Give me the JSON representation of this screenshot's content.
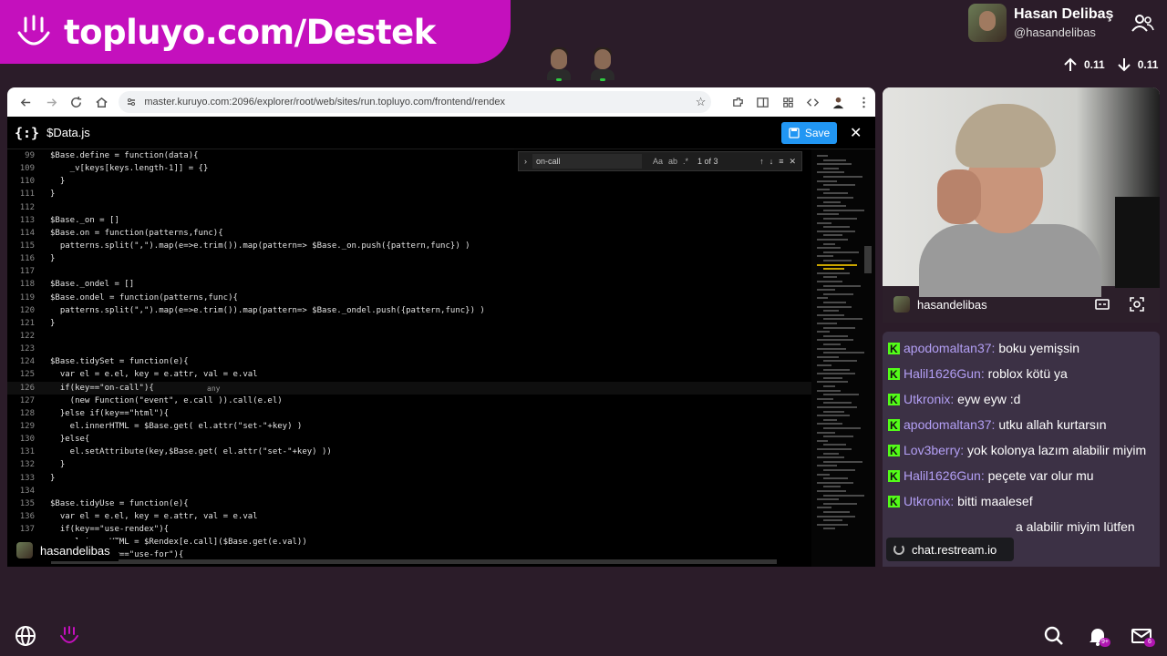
{
  "banner": {
    "text": "topluyo.com/Destek",
    "brand_color": "#c410bd"
  },
  "streamer": {
    "name": "Hasan Delibaş",
    "handle": "@hasandelibas"
  },
  "stats": {
    "up": "0.11",
    "down": "0.11"
  },
  "browser": {
    "url": "master.kuruyo.com:2096/explorer/root/web/sites/run.topluyo.com/frontend/rendex"
  },
  "editor": {
    "icon_text": "{:}",
    "filename": "$Data.js",
    "save_label": "Save",
    "find": {
      "query": "on-call",
      "count": "1 of 3"
    },
    "hover_hint": "any",
    "lines": [
      {
        "n": "99",
        "t": "$Base.define = function(data){"
      },
      {
        "n": "109",
        "t": "    _v[keys[keys.length-1]] = {}"
      },
      {
        "n": "110",
        "t": "  }"
      },
      {
        "n": "111",
        "t": "}"
      },
      {
        "n": "112",
        "t": ""
      },
      {
        "n": "113",
        "t": "$Base._on = []"
      },
      {
        "n": "114",
        "t": "$Base.on = function(patterns,func){"
      },
      {
        "n": "115",
        "t": "  patterns.split(\",\").map(e=>e.trim()).map(pattern=> $Base._on.push({pattern,func}) )"
      },
      {
        "n": "116",
        "t": "}"
      },
      {
        "n": "117",
        "t": ""
      },
      {
        "n": "118",
        "t": "$Base._ondel = []"
      },
      {
        "n": "119",
        "t": "$Base.ondel = function(patterns,func){"
      },
      {
        "n": "120",
        "t": "  patterns.split(\",\").map(e=>e.trim()).map(pattern=> $Base._ondel.push({pattern,func}) )"
      },
      {
        "n": "121",
        "t": "}"
      },
      {
        "n": "122",
        "t": ""
      },
      {
        "n": "123",
        "t": ""
      },
      {
        "n": "124",
        "t": "$Base.tidySet = function(e){"
      },
      {
        "n": "125",
        "t": "  var el = e.el, key = e.attr, val = e.val"
      },
      {
        "n": "126",
        "t": "  if(key==\"on-call\"){"
      },
      {
        "n": "127",
        "t": "    (new Function(\"event\", e.call )).call(e.el)"
      },
      {
        "n": "128",
        "t": "  }else if(key==\"html\"){"
      },
      {
        "n": "129",
        "t": "    el.innerHTML = $Base.get( el.attr(\"set-\"+key) )"
      },
      {
        "n": "130",
        "t": "  }else{"
      },
      {
        "n": "131",
        "t": "    el.setAttribute(key,$Base.get( el.attr(\"set-\"+key) ))"
      },
      {
        "n": "132",
        "t": "  }"
      },
      {
        "n": "133",
        "t": "}"
      },
      {
        "n": "134",
        "t": ""
      },
      {
        "n": "135",
        "t": "$Base.tidyUse = function(e){"
      },
      {
        "n": "136",
        "t": "  var el = e.el, key = e.attr, val = e.val"
      },
      {
        "n": "137",
        "t": "  if(key==\"use-rendex\"){"
      },
      {
        "n": "",
        "t": "    el.innerHTML = $Rendex[e.call]($Base.get(e.val))"
      },
      {
        "n": "",
        "t": "  }else if(key==\"use-for\"){"
      }
    ]
  },
  "strip_name": "hasandelibas",
  "cam": {
    "name": "hasandelibas"
  },
  "chat": {
    "messages": [
      {
        "user": "apodomaltan37:",
        "text": "boku yemişsin"
      },
      {
        "user": "Halil1626Gun:",
        "text": "roblox kötü ya"
      },
      {
        "user": "Utkronix:",
        "text": "eyw eyw :d"
      },
      {
        "user": "apodomaltan37:",
        "text": "utku allah kurtarsın"
      },
      {
        "user": "Lov3berry:",
        "text": "yok kolonya lazım alabilir miyim"
      },
      {
        "user": "Halil1626Gun:",
        "text": "peçete var olur mu"
      },
      {
        "user": "Utkronix:",
        "text": "bitti maalesef"
      },
      {
        "user": "",
        "text": "a alabilir miyim lütfen"
      }
    ],
    "overlay": "chat.restream.io"
  },
  "bottom": {
    "notif_badge": "9+",
    "mail_badge": "6"
  }
}
